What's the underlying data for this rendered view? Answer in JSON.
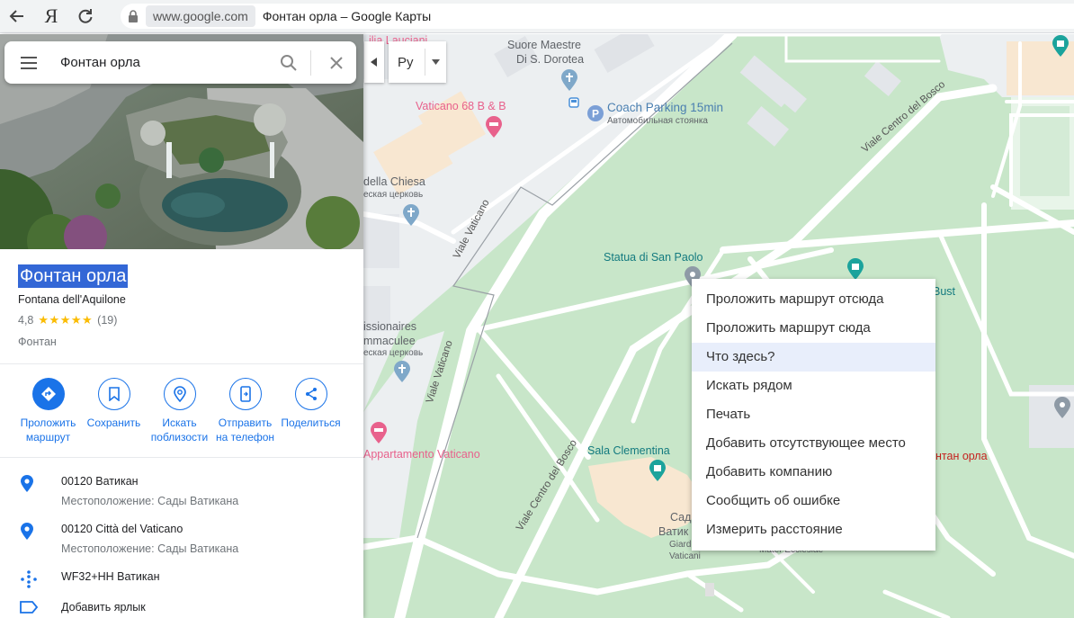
{
  "browser": {
    "domain": "www.google.com",
    "title": "Фонтан орла – Google Карты",
    "back_icon": "arrow-left-icon",
    "yandex_label": "Я",
    "reload_icon": "reload-icon"
  },
  "search": {
    "value": "Фонтан орла"
  },
  "place": {
    "name": "Фонтан орла",
    "original_name": "Fontana dell'Aquilone",
    "rating": "4,8",
    "stars": "★★★★★",
    "reviews": "(19)",
    "category": "Фонтан"
  },
  "actions": [
    {
      "label1": "Проложить",
      "label2": "маршрут"
    },
    {
      "label1": "Сохранить",
      "label2": ""
    },
    {
      "label1": "Искать",
      "label2": "поблизости"
    },
    {
      "label1": "Отправить",
      "label2": "на телефон"
    },
    {
      "label1": "Поделиться",
      "label2": ""
    }
  ],
  "info": {
    "address1": "00120 Ватикан",
    "location1": "Местоположение: Сады Ватикана",
    "address2": "00120 Città del Vaticano",
    "location2": "Местоположение: Сады Ватикана",
    "plus_code": "WF32+HH Ватикан",
    "add_label": "Добавить ярлык"
  },
  "map_controls": {
    "language": "Ру"
  },
  "map_labels": {
    "lauciani": "ilia Lauciani",
    "suore": "Suore Maestre",
    "suore2": "Di S. Dorotea",
    "vaticano68": "Vaticano 68 B & B",
    "coach": "Coach Parking 15min",
    "coach_sub": "Автомобильная стоянка",
    "della_chiesa": "della Chiesa",
    "church_sub1": "еская церковь",
    "viale_vaticano1": "Viale Vaticano",
    "viale_vaticano2": "Viale Vaticano",
    "viale_bosco1": "Viale Centro del Bosco",
    "viale_bosco2": "Viale Centro del Bosco",
    "statua": "Statua di San Paolo",
    "bust": "Bust",
    "missionaries": "issionaires",
    "immaculee": "mmaculee",
    "church_sub2": "еская церковь",
    "appartamento": "Appartamento Vaticano",
    "sala": "Sala Clementina",
    "fontan_orla": "нтан орла",
    "sady": "Сад",
    "vatik": "Ватик",
    "giard": "Giard",
    "vaticani": "Vaticani",
    "mater": "Mater Ecclesiae"
  },
  "context_menu": [
    "Проложить маршрут отсюда",
    "Проложить маршрут сюда",
    "Что здесь?",
    "Искать рядом",
    "Печать",
    "Добавить отсутствующее место",
    "Добавить компанию",
    "Сообщить об ошибке",
    "Измерить расстояние"
  ],
  "colors": {
    "park": "#c8e6c9",
    "road": "#ffffff",
    "urban": "#eceff1",
    "accent": "#1a73e8",
    "selection": "#3367d6",
    "star": "#fbbc04"
  }
}
